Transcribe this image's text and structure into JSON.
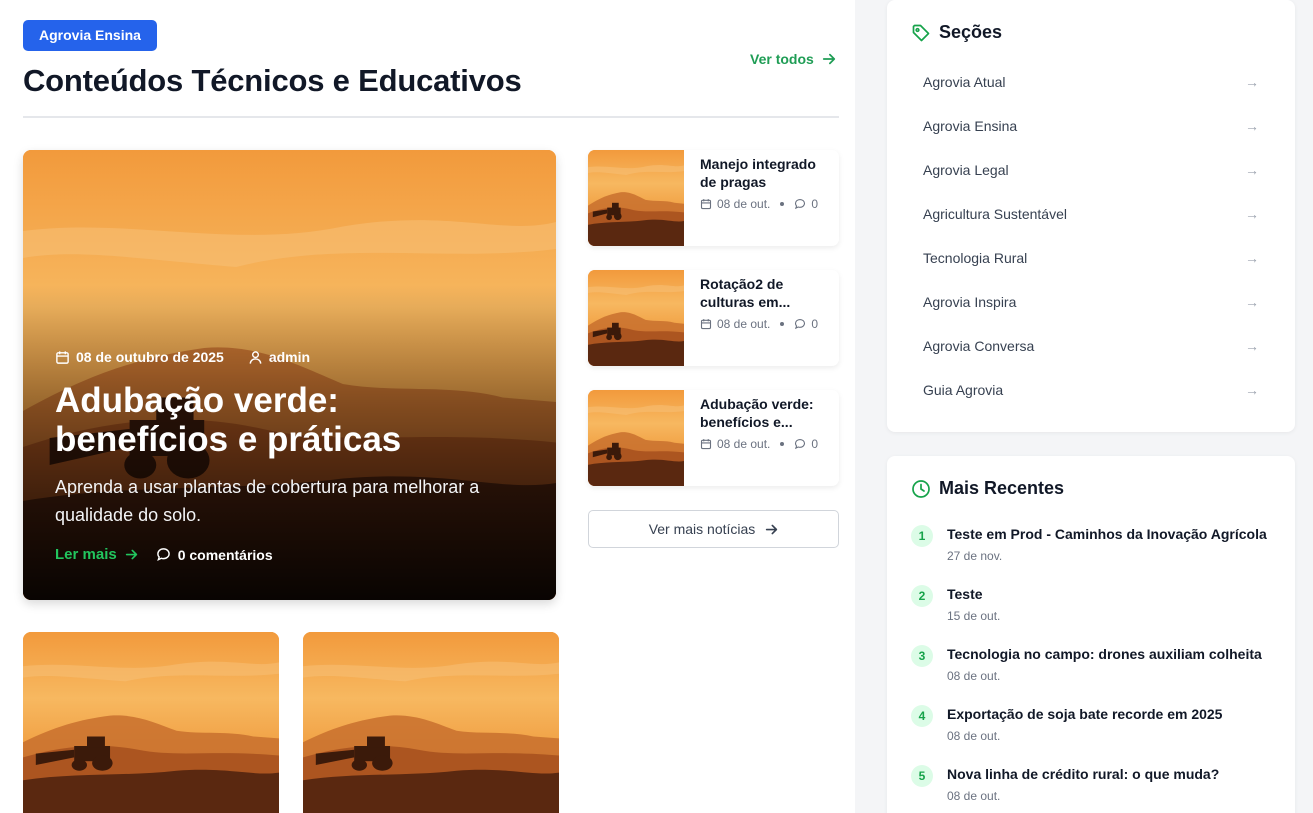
{
  "section": {
    "badge": "Agrovia Ensina",
    "title": "Conteúdos Técnicos e Educativos",
    "see_all": "Ver todos"
  },
  "hero": {
    "date": "08 de outubro de 2025",
    "author": "admin",
    "title": "Adubação verde: benefícios e práticas",
    "excerpt": "Aprenda a usar plantas de cobertura para melhorar a qualidade do solo.",
    "read_more": "Ler mais",
    "comments": "0 comentários"
  },
  "side_posts": [
    {
      "title": "Manejo integrado de pragas",
      "date": "08 de out.",
      "comments": "0"
    },
    {
      "title": "Rotação2 de culturas em...",
      "date": "08 de out.",
      "comments": "0"
    },
    {
      "title": "Adubação verde: benefícios e...",
      "date": "08 de out.",
      "comments": "0"
    }
  ],
  "more_news": "Ver mais notícias",
  "sidebar": {
    "sections_title": "Seções",
    "sections": [
      {
        "label": "Agrovia Atual",
        "arrow": "→"
      },
      {
        "label": "Agrovia Ensina",
        "arrow": "→"
      },
      {
        "label": "Agrovia Legal",
        "arrow": "→"
      },
      {
        "label": "Agricultura Sustentável",
        "arrow": "→"
      },
      {
        "label": "Tecnologia Rural",
        "arrow": "→"
      },
      {
        "label": "Agrovia Inspira",
        "arrow": "→"
      },
      {
        "label": "Agrovia Conversa",
        "arrow": "→"
      },
      {
        "label": "Guia Agrovia",
        "arrow": "→"
      }
    ],
    "recent_title": "Mais Recentes",
    "recent": [
      {
        "n": "1",
        "title": "Teste em Prod - Caminhos da Inovação Agrícola",
        "date": "27 de nov."
      },
      {
        "n": "2",
        "title": "Teste",
        "date": "15 de out."
      },
      {
        "n": "3",
        "title": "Tecnologia no campo: drones auxiliam colheita",
        "date": "08 de out."
      },
      {
        "n": "4",
        "title": "Exportação de soja bate recorde em 2025",
        "date": "08 de out."
      },
      {
        "n": "5",
        "title": "Nova linha de crédito rural: o que muda?",
        "date": "08 de out."
      }
    ]
  },
  "colors": {
    "badge": "#2563eb",
    "accent_green": "#22c55e",
    "link_green": "#1f9d55"
  }
}
